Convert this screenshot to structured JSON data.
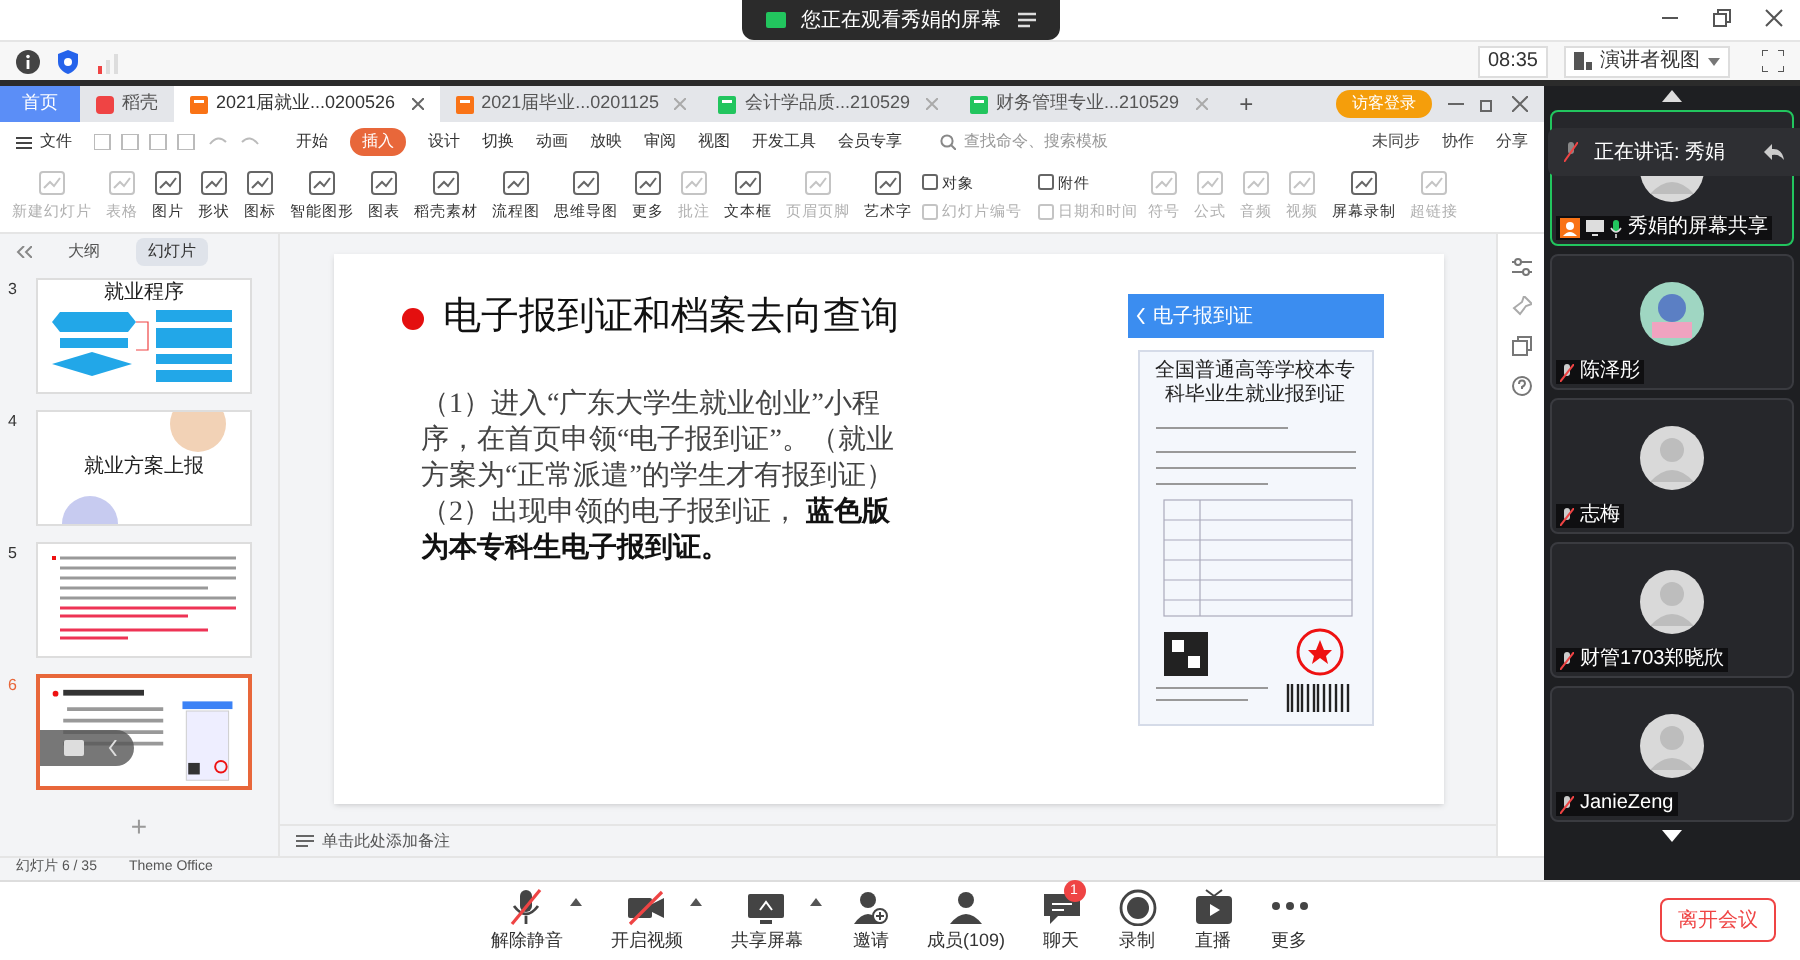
{
  "meeting_bar": {
    "watching": "您正在观看秀娟的屏幕"
  },
  "info_bar": {
    "time": "08:35",
    "view_button": "演讲者视图"
  },
  "wps": {
    "tabs": [
      {
        "label": "首页",
        "kind": "home",
        "selected": false
      },
      {
        "label": "稻壳",
        "kind": "docer",
        "selected": false
      },
      {
        "label": "2021届就业...0200526",
        "kind": "ppt",
        "selected": true
      },
      {
        "label": "2021届毕业...0201125",
        "kind": "ppt",
        "selected": false
      },
      {
        "label": "会计学品质...210529",
        "kind": "sheet",
        "selected": false
      },
      {
        "label": "财务管理专业...210529",
        "kind": "sheet",
        "selected": false
      }
    ],
    "new_tab": "+",
    "login_button": "访客登录",
    "file_menu": "文件",
    "menu": [
      {
        "label": "开始",
        "selected": false
      },
      {
        "label": "插入",
        "selected": true
      },
      {
        "label": "设计",
        "selected": false
      },
      {
        "label": "切换",
        "selected": false
      },
      {
        "label": "动画",
        "selected": false
      },
      {
        "label": "放映",
        "selected": false
      },
      {
        "label": "审阅",
        "selected": false
      },
      {
        "label": "视图",
        "selected": false
      },
      {
        "label": "开发工具",
        "selected": false
      },
      {
        "label": "会员专享",
        "selected": false
      }
    ],
    "search": {
      "placeholder": "查找命令、搜索模板"
    },
    "actions": [
      "未同步",
      "协作",
      "分享"
    ],
    "toolbar": [
      {
        "label": "新建幻灯片",
        "disabled": true
      },
      {
        "label": "表格",
        "disabled": true
      },
      {
        "label": "图片",
        "disabled": false
      },
      {
        "label": "形状",
        "disabled": false
      },
      {
        "label": "图标",
        "disabled": false
      },
      {
        "label": "智能图形",
        "disabled": false
      },
      {
        "label": "图表",
        "disabled": false
      },
      {
        "label": "稻壳素材",
        "disabled": false
      },
      {
        "label": "流程图",
        "disabled": false
      },
      {
        "label": "思维导图",
        "disabled": false
      },
      {
        "label": "更多",
        "disabled": false
      },
      {
        "label": "批注",
        "disabled": true
      },
      {
        "label": "文本框",
        "disabled": false
      },
      {
        "label": "页眉页脚",
        "disabled": true
      },
      {
        "label": "艺术字",
        "disabled": false
      }
    ],
    "toolbar_small": [
      {
        "label": "对象",
        "disabled": false
      },
      {
        "label": "附件",
        "disabled": false
      },
      {
        "label": "幻灯片编号",
        "disabled": true
      },
      {
        "label": "日期和时间",
        "disabled": true
      }
    ],
    "toolbar_tail": [
      {
        "label": "符号",
        "disabled": true
      },
      {
        "label": "公式",
        "disabled": true
      },
      {
        "label": "音频",
        "disabled": true
      },
      {
        "label": "视频",
        "disabled": true
      },
      {
        "label": "屏幕录制",
        "disabled": false
      },
      {
        "label": "超链接",
        "disabled": true
      }
    ],
    "panel_tabs": [
      {
        "label": "大纲",
        "selected": false
      },
      {
        "label": "幻灯片",
        "selected": true
      }
    ],
    "slides": [
      {
        "number": "3",
        "title": "就业程序",
        "kind": "flow",
        "selected": false
      },
      {
        "number": "4",
        "title": "就业方案上报",
        "kind": "cover",
        "selected": false
      },
      {
        "number": "5",
        "kind": "text",
        "selected": false
      },
      {
        "number": "6",
        "kind": "current",
        "selected": true
      }
    ],
    "add_slide": "+",
    "slide": {
      "title": "电子报到证和档案去向查询",
      "body": "（1）进入“广东大学生就业创业”小程序，在首页申领“电子报到证”。（就业方案为“正常派遣”的学生才有报到证）（2）出现申领的电子报到证， **蓝色版为本专科生电子报到证。**",
      "phone_header": "电子报到证",
      "certificate_title": "全国普通高等学校本专科毕业生就业报到证"
    },
    "notes_placeholder": "单击此处添加备注",
    "status": [
      "幻灯片 6 / 35",
      "Theme Office"
    ]
  },
  "speaking": {
    "text": "正在讲话: 秀娟"
  },
  "participants": [
    {
      "name": "秀娟的屏幕共享",
      "kind": "share",
      "active": true
    },
    {
      "name": "陈泽彤",
      "kind": "avatar",
      "active": false
    },
    {
      "name": "志梅",
      "kind": "default",
      "active": false
    },
    {
      "name": "财管1703郑晓欣",
      "kind": "default",
      "active": false
    },
    {
      "name": "JanieZeng",
      "kind": "default",
      "active": false
    }
  ],
  "controls": [
    {
      "label": "解除静音",
      "kind": "mic-off",
      "caret": true
    },
    {
      "label": "开启视频",
      "kind": "video-off",
      "caret": true
    },
    {
      "label": "共享屏幕",
      "kind": "screen",
      "caret": true
    },
    {
      "label": "邀请",
      "kind": "invite",
      "caret": false
    },
    {
      "label": "成员(109)",
      "kind": "members",
      "caret": false
    },
    {
      "label": "聊天",
      "kind": "chat",
      "caret": false,
      "badge": "1"
    },
    {
      "label": "录制",
      "kind": "record",
      "caret": false
    },
    {
      "label": "直播",
      "kind": "live",
      "caret": false
    },
    {
      "label": "更多",
      "kind": "more",
      "caret": false
    }
  ],
  "leave_button": "离开会议"
}
